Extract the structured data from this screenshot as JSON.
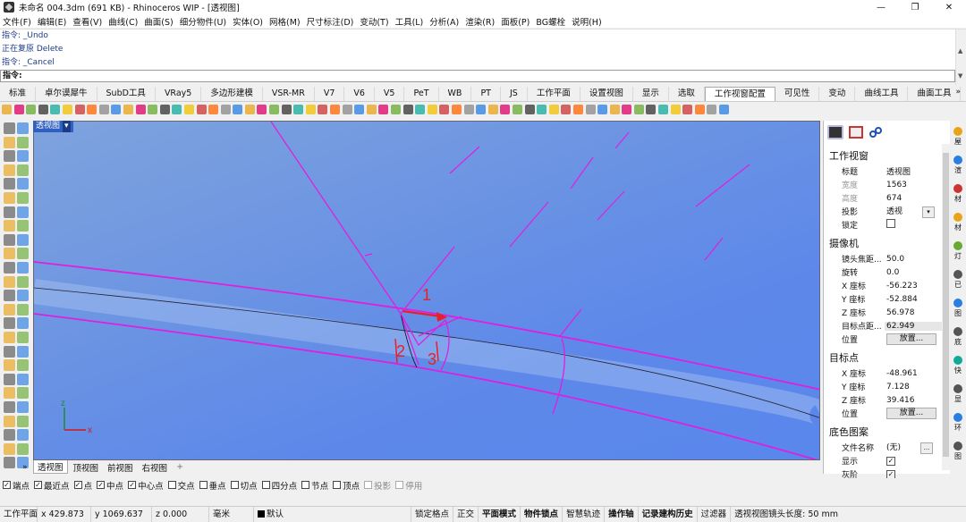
{
  "window": {
    "title": "未命名 004.3dm (691 KB) - Rhinoceros WIP - [透视图]",
    "btn_min": "—",
    "btn_max": "❐",
    "btn_close": "✕"
  },
  "menu": [
    "文件(F)",
    "编辑(E)",
    "查看(V)",
    "曲线(C)",
    "曲面(S)",
    "细分物件(U)",
    "实体(O)",
    "网格(M)",
    "尺寸标注(D)",
    "变动(T)",
    "工具(L)",
    "分析(A)",
    "渲染(R)",
    "面板(P)",
    "BG螺栓",
    "说明(H)"
  ],
  "command_history": [
    "指令: _Undo",
    "正在复原 Delete",
    "指令: _Cancel"
  ],
  "command_prompt": "指令:",
  "tabs": [
    "标准",
    "卓尔谟犀牛",
    "SubD工具",
    "VRay5",
    "多边形建模",
    "VSR-MR",
    "V7",
    "V6",
    "V5",
    "PeT",
    "WB",
    "PT",
    "JS",
    "工作平面",
    "设置视图",
    "显示",
    "选取",
    "工作视窗配置",
    "可见性",
    "变动",
    "曲线工具",
    "曲面工具",
    "实体"
  ],
  "active_tab": "工作视窗配置",
  "tabs_more": "»",
  "viewport": {
    "label": "透视图",
    "label_dd": "▾",
    "annotations": [
      "1",
      "2",
      "3"
    ],
    "axis_x": "x",
    "axis_y": "z"
  },
  "viewport_tabs": [
    "透视图",
    "顶视图",
    "前视图",
    "右视图"
  ],
  "viewport_tab_add": "+",
  "left_arrow": "»",
  "panel": {
    "section_viewport": "工作视窗",
    "title_k": "标题",
    "title_v": "透视图",
    "width_k": "宽度",
    "width_v": "1563",
    "height_k": "高度",
    "height_v": "674",
    "proj_k": "投影",
    "proj_v": "透视",
    "lock_k": "锁定",
    "section_camera": "摄像机",
    "focal_k": "镜头焦距...",
    "focal_v": "50.0",
    "rot_k": "旋转",
    "rot_v": "0.0",
    "cx_k": "X 座标",
    "cx_v": "-56.223",
    "cy_k": "Y 座标",
    "cy_v": "-52.884",
    "cz_k": "Z 座标",
    "cz_v": "56.978",
    "tdist_k": "目标点距...",
    "tdist_v": "62.949",
    "pos_k": "位置",
    "place_btn": "放置...",
    "section_target": "目标点",
    "tx_k": "X 座标",
    "tx_v": "-48.961",
    "ty_k": "Y 座标",
    "ty_v": "7.128",
    "tz_k": "Z 座标",
    "tz_v": "39.416",
    "tpos_k": "位置",
    "place_btn2": "放置...",
    "section_bg": "底色图案",
    "file_k": "文件名称",
    "file_v": "(无)",
    "file_btn": "...",
    "show_k": "显示",
    "gray_k": "灰阶",
    "check": "✓"
  },
  "side_tabs": [
    "屋",
    "渲",
    "材",
    "材",
    "灯",
    "已",
    "图",
    "底",
    "快",
    "显",
    "环",
    "图"
  ],
  "osnaps": [
    {
      "label": "端点",
      "on": true
    },
    {
      "label": "最近点",
      "on": true
    },
    {
      "label": "点",
      "on": true
    },
    {
      "label": "中点",
      "on": true
    },
    {
      "label": "中心点",
      "on": true
    },
    {
      "label": "交点",
      "on": false
    },
    {
      "label": "垂点",
      "on": false
    },
    {
      "label": "切点",
      "on": false
    },
    {
      "label": "四分点",
      "on": false
    },
    {
      "label": "节点",
      "on": false
    },
    {
      "label": "顶点",
      "on": false
    },
    {
      "label": "投影",
      "on": false,
      "disabled": true
    },
    {
      "label": "停用",
      "on": false,
      "disabled": true
    }
  ],
  "status": {
    "cplane": "工作平面",
    "x": "x 429.873",
    "y": "y 1069.637",
    "z": "z 0.000",
    "unit": "毫米",
    "layer": "默认",
    "grid_snap": "锁定格点",
    "ortho": "正交",
    "planar": "平面模式",
    "osnap": "物件锁点",
    "smarttrack": "智慧轨迹",
    "gumball": "操作轴",
    "history": "记录建构历史",
    "filter": "过滤器",
    "message": "透视视图镜头长度: 50 mm"
  },
  "colors": {
    "viewport_bg": "#5d88ea",
    "curve_magenta": "#e01ee0",
    "annotation_red": "#e8202a"
  }
}
